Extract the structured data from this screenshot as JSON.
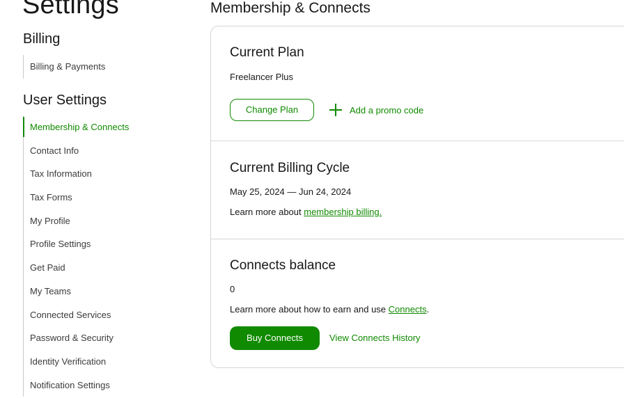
{
  "page": {
    "title": "Settings"
  },
  "sidebar": {
    "billing_heading": "Billing",
    "billing_items": [
      {
        "label": "Billing & Payments"
      }
    ],
    "user_settings_heading": "User Settings",
    "user_items": [
      {
        "label": "Membership & Connects",
        "active": true
      },
      {
        "label": "Contact Info"
      },
      {
        "label": "Tax Information"
      },
      {
        "label": "Tax Forms"
      },
      {
        "label": "My Profile"
      },
      {
        "label": "Profile Settings"
      },
      {
        "label": "Get Paid"
      },
      {
        "label": "My Teams"
      },
      {
        "label": "Connected Services"
      },
      {
        "label": "Password & Security"
      },
      {
        "label": "Identity Verification"
      },
      {
        "label": "Notification Settings"
      }
    ]
  },
  "main": {
    "title": "Membership & Connects",
    "plan": {
      "heading": "Current Plan",
      "name": "Freelancer Plus",
      "change_button": "Change Plan",
      "promo_link": "Add a promo code"
    },
    "billing_cycle": {
      "heading": "Current Billing Cycle",
      "dates": "May 25, 2024 — Jun 24, 2024",
      "learn_prefix": "Learn more about ",
      "learn_link": "membership billing."
    },
    "connects": {
      "heading": "Connects balance",
      "balance": "0",
      "learn_prefix": "Learn more about how to earn and use ",
      "learn_link": "Connects",
      "learn_suffix": ".",
      "buy_button": "Buy Connects",
      "history_link": "View Connects History"
    }
  },
  "colors": {
    "accent": "#108a00",
    "text": "#181818",
    "border": "#d5d5d5"
  }
}
